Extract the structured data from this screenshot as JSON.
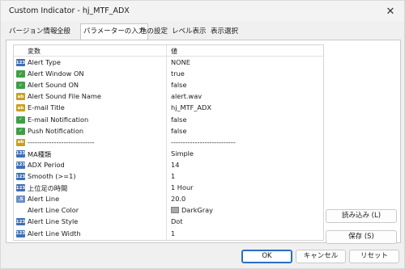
{
  "window": {
    "title": "Custom Indicator - hj_MTF_ADX"
  },
  "icons": {
    "close": "close-icon",
    "int": "integer-type-icon",
    "bool": "boolean-type-icon",
    "str": "string-type-icon",
    "dbl": "double-type-icon",
    "color": "color-type-icon"
  },
  "tabs": [
    {
      "label": "バージョン情報"
    },
    {
      "label": "全般"
    },
    {
      "label": "パラメーターの入力"
    },
    {
      "label": "色の設定"
    },
    {
      "label": "レベル表示"
    },
    {
      "label": "表示選択"
    }
  ],
  "table": {
    "headers": {
      "variable": "変数",
      "value": "値"
    },
    "rows": [
      {
        "name": "Alert Type",
        "value": "NONE",
        "type": "int"
      },
      {
        "name": "Alert Window ON",
        "value": "true",
        "type": "bool"
      },
      {
        "name": "Alert Sound ON",
        "value": "false",
        "type": "bool"
      },
      {
        "name": "Alert Sound File Name",
        "value": "alert.wav",
        "type": "str"
      },
      {
        "name": "E-mail Title",
        "value": "hj_MTF_ADX",
        "type": "str"
      },
      {
        "name": "E-mail Notification",
        "value": "false",
        "type": "bool"
      },
      {
        "name": "Push Notification",
        "value": "false",
        "type": "bool"
      },
      {
        "name": "----------------------------",
        "value": "---------------------------",
        "type": "str"
      },
      {
        "name": "MA種類",
        "value": "Simple",
        "type": "int"
      },
      {
        "name": "ADX Period",
        "value": "14",
        "type": "int"
      },
      {
        "name": "Smooth (>=1)",
        "value": "1",
        "type": "int"
      },
      {
        "name": "上位足の時間",
        "value": "1 Hour",
        "type": "int"
      },
      {
        "name": "Alert Line",
        "value": "20.0",
        "type": "dbl"
      },
      {
        "name": "Alert Line Color",
        "value": "DarkGray",
        "type": "color",
        "swatch": "#a9a9a9"
      },
      {
        "name": "Alert Line Style",
        "value": "Dot",
        "type": "int"
      },
      {
        "name": "Alert Line Width",
        "value": "1",
        "type": "int"
      }
    ]
  },
  "buttons": {
    "load": "読み込み (L)",
    "save": "保存 (S)",
    "ok": "OK",
    "cancel": "キャンセル",
    "reset": "リセット"
  },
  "colors": {
    "accent": "#2b6cc4",
    "swatch_darkgray": "#a9a9a9"
  }
}
